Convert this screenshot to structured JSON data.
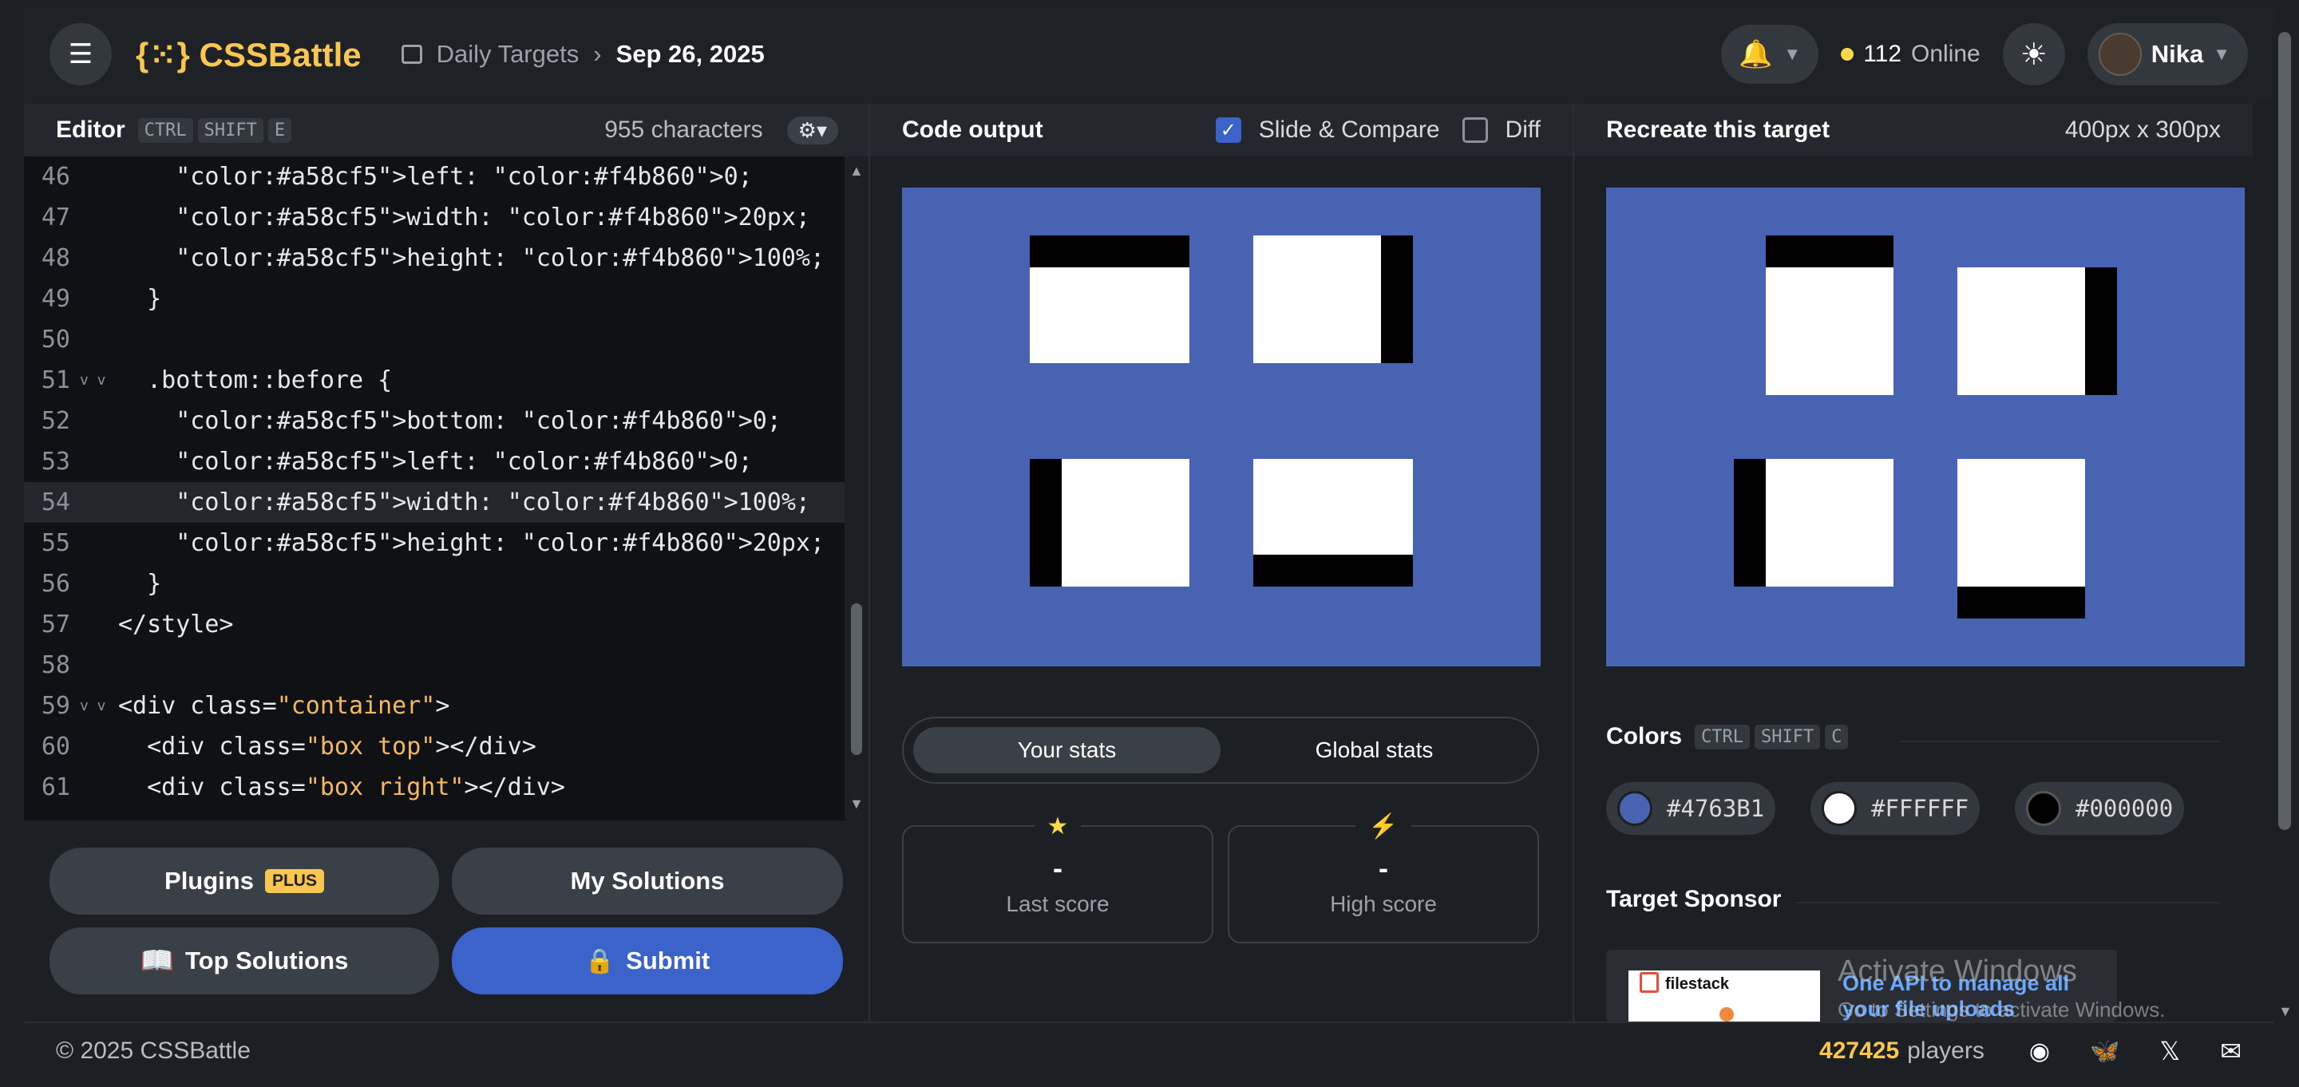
{
  "header": {
    "logo": "{⁙} CSSBattle",
    "breadcrumb_parent": "Daily Targets",
    "breadcrumb_date": "Sep 26, 2025",
    "online_count": "112",
    "online_label": "Online",
    "user_name": "Nika"
  },
  "editor": {
    "title": "Editor",
    "shortcut": [
      "CTRL",
      "SHIFT",
      "E"
    ],
    "char_count": "955 characters",
    "lines": [
      {
        "num": "46",
        "code": "    left: 0;"
      },
      {
        "num": "47",
        "code": "    width: 20px;"
      },
      {
        "num": "48",
        "code": "    height: 100%;"
      },
      {
        "num": "49",
        "code": "  }"
      },
      {
        "num": "50",
        "code": ""
      },
      {
        "num": "51",
        "code": "  .bottom::before {"
      },
      {
        "num": "52",
        "code": "    bottom: 0;"
      },
      {
        "num": "53",
        "code": "    left: 0;"
      },
      {
        "num": "54",
        "code": "    width: 100%;"
      },
      {
        "num": "55",
        "code": "    height: 20px;"
      },
      {
        "num": "56",
        "code": "  }"
      },
      {
        "num": "57",
        "code": "</style>"
      },
      {
        "num": "58",
        "code": ""
      },
      {
        "num": "59",
        "code": "<div class=\"container\">"
      },
      {
        "num": "60",
        "code": "  <div class=\"box top\"></div>"
      },
      {
        "num": "61",
        "code": "  <div class=\"box right\"></div>"
      }
    ]
  },
  "buttons": {
    "plugins": "Plugins",
    "plus_badge": "PLUS",
    "my_solutions": "My Solutions",
    "top_solutions": "Top Solutions",
    "submit": "Submit"
  },
  "output": {
    "title": "Code output",
    "slide_compare": "Slide & Compare",
    "diff": "Diff",
    "your_stats": "Your stats",
    "global_stats": "Global stats",
    "last_score_value": "-",
    "last_score_label": "Last score",
    "high_score_value": "-",
    "high_score_label": "High score"
  },
  "target": {
    "title": "Recreate this target",
    "size": "400px x 300px",
    "colors_title": "Colors",
    "colors_shortcut": [
      "CTRL",
      "SHIFT",
      "C"
    ],
    "colors": [
      "#4763B1",
      "#FFFFFF",
      "#000000"
    ],
    "sponsor_title": "Target Sponsor",
    "sponsor_name": "filestack",
    "sponsor_text": "One API to manage all your file uploads"
  },
  "watermark": {
    "line1": "Activate Windows",
    "line2": "Go to Settings to activate Windows."
  },
  "footer": {
    "copyright": "© 2025 CSSBattle",
    "players_count": "427425",
    "players_label": "players"
  },
  "theme": {
    "accent": "#3c63c9",
    "target_bg": "#4763b1",
    "yellow": "#f9c74f"
  }
}
